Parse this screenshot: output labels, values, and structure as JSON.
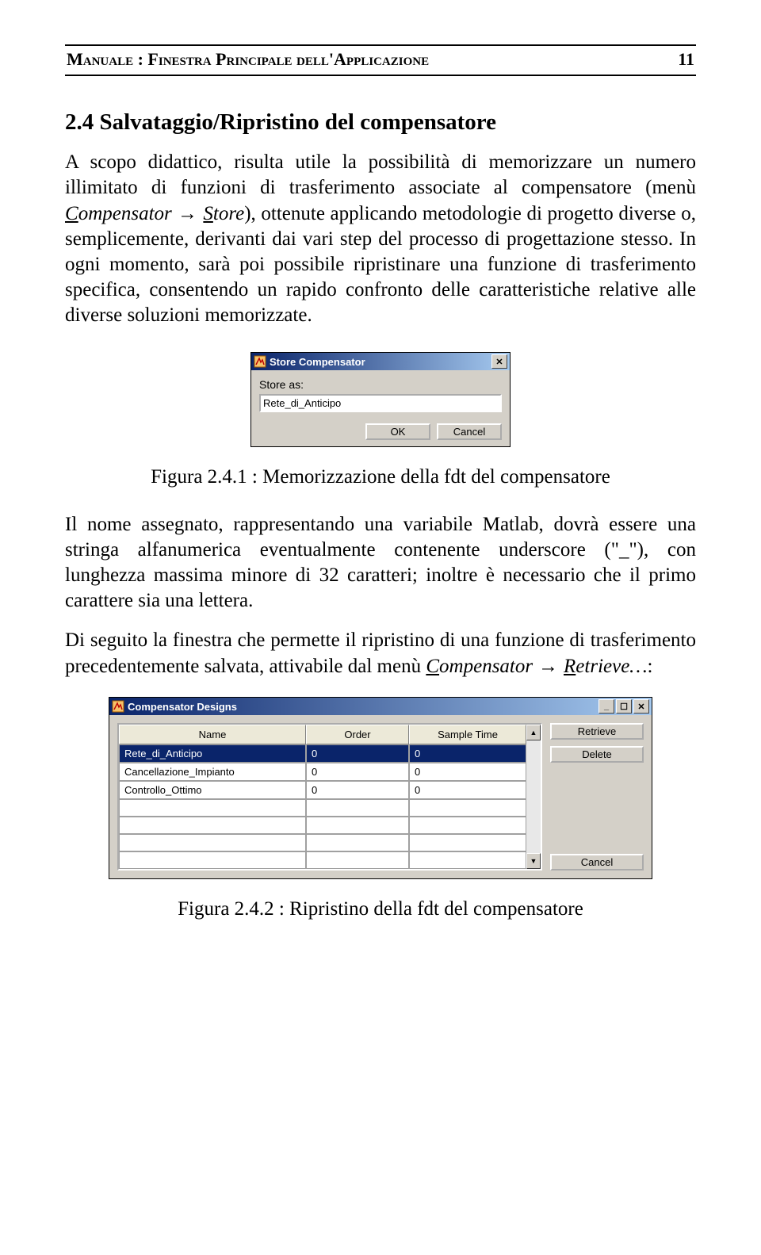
{
  "header": {
    "title_left": "Manuale : Finestra Principale dell'Applicazione",
    "page_no": "11"
  },
  "sec": {
    "heading": "2.4 Salvataggio/Ripristino del compensatore",
    "p1_a": "A scopo didattico, risulta utile la possibilità di memorizzare un numero illimitato di funzioni di trasferimento associate al compensatore (menù ",
    "p1_menu1": "C",
    "p1_menu1b": "ompensator",
    "p1_arrow": " → ",
    "p1_menu2": "S",
    "p1_menu2b": "tore",
    "p1_b": "), ottenute applicando metodologie di progetto diverse o, semplicemente, derivanti dai vari step del processo di progettazione stesso. In ogni momento, sarà poi possibile ripristinare una funzione di trasferimento specifica, consentendo un rapido confronto delle caratteristiche relative alle diverse soluzioni memorizzate.",
    "p2": "Il nome assegnato, rappresentando una variabile Matlab, dovrà essere una stringa alfanumerica eventualmente contenente underscore (\"_\"), con lunghezza massima minore di 32 caratteri; inoltre è necessario che il primo carattere sia una lettera.",
    "p3_a": "Di seguito la finestra che permette il ripristino di una funzione di trasferimento precedentemente salvata, attivabile dal menù ",
    "p3_menu1": "C",
    "p3_menu1b": "ompensator",
    "p3_arrow": " → ",
    "p3_menu2": "R",
    "p3_menu2b": "etrieve…",
    "p3_colon": ":"
  },
  "fig1": {
    "caption": "Figura 2.4.1 : Memorizzazione della fdt del compensatore"
  },
  "fig2": {
    "caption": "Figura 2.4.2 : Ripristino della fdt del compensatore"
  },
  "store_dialog": {
    "title": "Store Compensator",
    "label": "Store as:",
    "value": "Rete_di_Anticipo",
    "ok": "OK",
    "cancel": "Cancel"
  },
  "designs_dialog": {
    "title": "Compensator Designs",
    "cols": {
      "name": "Name",
      "order": "Order",
      "sample": "Sample Time"
    },
    "rows": [
      {
        "name": "Rete_di_Anticipo",
        "order": "0",
        "sample": "0"
      },
      {
        "name": "Cancellazione_Impianto",
        "order": "0",
        "sample": "0"
      },
      {
        "name": "Controllo_Ottimo",
        "order": "0",
        "sample": "0"
      }
    ],
    "retrieve": "Retrieve",
    "delete": "Delete",
    "cancel": "Cancel"
  }
}
